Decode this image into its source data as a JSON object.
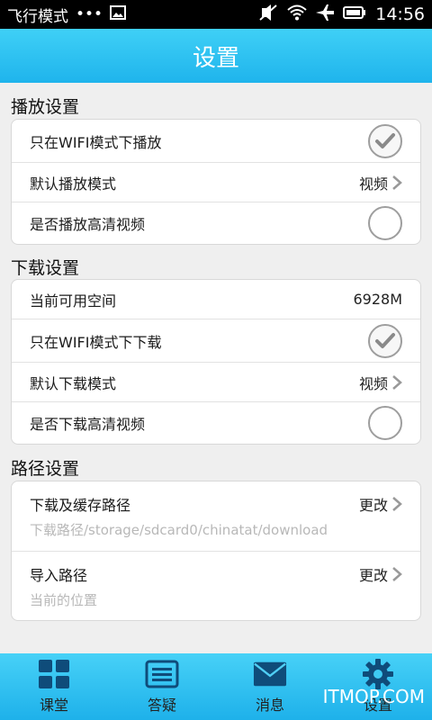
{
  "status_bar": {
    "mode_text": "飞行模式",
    "dots": "•••",
    "time": "14:56"
  },
  "header": {
    "title": "设置"
  },
  "playback": {
    "title": "播放设置",
    "wifi_only": {
      "label": "只在WIFI模式下播放",
      "checked": true
    },
    "default_mode": {
      "label": "默认播放模式",
      "value": "视频"
    },
    "hd": {
      "label": "是否播放高清视频",
      "checked": false
    }
  },
  "download": {
    "title": "下载设置",
    "space": {
      "label": "当前可用空间",
      "value": "6928M"
    },
    "wifi_only": {
      "label": "只在WIFI模式下下载",
      "checked": true
    },
    "default_mode": {
      "label": "默认下载模式",
      "value": "视频"
    },
    "hd": {
      "label": "是否下载高清视频",
      "checked": false
    }
  },
  "paths": {
    "title": "路径设置",
    "cache": {
      "label": "下载及缓存路径",
      "action": "更改",
      "sub": "下载路径/storage/sdcard0/chinatat/download"
    },
    "import": {
      "label": "导入路径",
      "action": "更改",
      "sub": "当前的位置"
    }
  },
  "tabs": [
    {
      "label": "课堂",
      "icon": "grid-icon"
    },
    {
      "label": "答疑",
      "icon": "list-icon"
    },
    {
      "label": "消息",
      "icon": "envelope-icon"
    },
    {
      "label": "设置",
      "icon": "gear-icon"
    }
  ],
  "watermark": "ITMOP.COM"
}
